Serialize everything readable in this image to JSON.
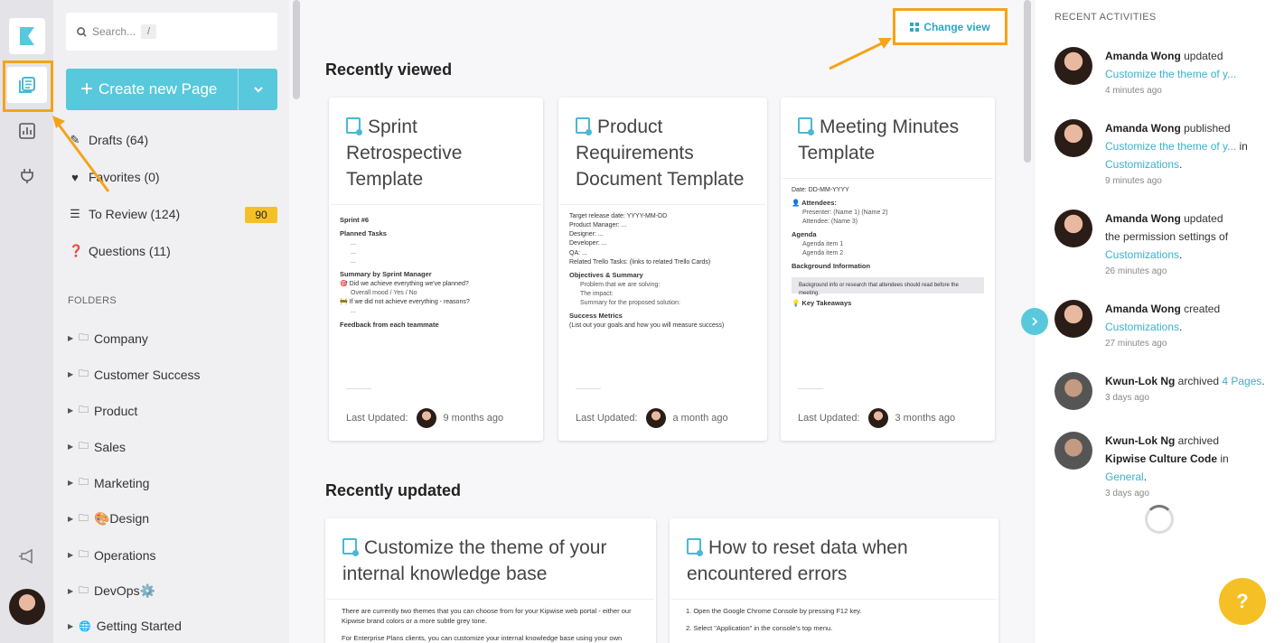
{
  "sidebar": {
    "search_placeholder": "Search...",
    "search_shortcut": "/",
    "create_label": "Create new Page",
    "nav": [
      {
        "label": "Drafts (64)",
        "icon": "pencil-icon"
      },
      {
        "label": "Favorites (0)",
        "icon": "heart-icon"
      },
      {
        "label": "To Review (124)",
        "icon": "review-list-icon",
        "badge": "90"
      },
      {
        "label": "Questions (11)",
        "icon": "question-icon"
      }
    ],
    "folders_title": "FOLDERS",
    "folders": [
      "Company",
      "Customer Success",
      "Product",
      "Sales",
      "Marketing",
      "🎨Design",
      "Operations",
      "DevOps⚙️",
      "Getting Started"
    ]
  },
  "main": {
    "change_view": "Change view",
    "recently_viewed": "Recently viewed",
    "recently_updated": "Recently updated",
    "last_updated_label": "Last Updated:",
    "viewed_cards": [
      {
        "title": "Sprint Retrospective Template",
        "time": "9 months ago"
      },
      {
        "title": "Product Requirements Document Template",
        "time": "a month ago"
      },
      {
        "title": "Meeting Minutes Template",
        "time": "3 months ago"
      }
    ],
    "updated_cards": [
      {
        "title": "Customize the theme of your internal knowledge base",
        "preview1": "There are currently two themes that you can choose from for your Kipwise web portal - either our Kipwise brand colors or a more subtle grey tone.",
        "preview2": "For Enterprise Plans clients, you can customize your internal knowledge base using your own brand"
      },
      {
        "title": "How to reset data when encountered errors",
        "preview1": "1. Open the Google Chrome Console by pressing F12 key.",
        "preview2": "2. Select \"Application\" in the console's top menu."
      }
    ],
    "previews": {
      "sprint": {
        "h": "Sprint #6",
        "planned": "Planned Tasks",
        "dash": "...",
        "summary": "Summary by Sprint Manager",
        "q1": "🎯 Did we achieve everything we've planned?",
        "q1a": "Overall mood / Yes / No",
        "q2": "🚧 If we did not achieve everything - reasons?",
        "feedback": "Feedback from each teammate"
      },
      "prd": {
        "release": "Target release date: YYYY-MM-DD",
        "pm": "Product Manager: ...",
        "designer": "Designer: ...",
        "dev": "Developer: ...",
        "qa": "QA: ...",
        "tasks": "Related Trello Tasks: (links to related Trello Cards)",
        "obj": "Objectives & Summary",
        "o1": "Problem that we are solving:",
        "o2": "The impact:",
        "o3": "Summary for the proposed solution:",
        "metrics": "Success Metrics",
        "m1": "(List out your goals and how you will measure success)"
      },
      "mm": {
        "date": "Date: DD-MM-YYYY",
        "attendees": "👤 Attendees:",
        "a1": "Presenter: (Name 1) (Name 2)",
        "a2": "Attendee: (Name 3)",
        "agenda": "Agenda",
        "g1": "Agenda item 1",
        "g2": "Agenda item 2",
        "bg": "Background Information",
        "bgnote": "Background info or research that attendees should read before the meeting.",
        "takeaways": "💡 Key Takeaways"
      }
    }
  },
  "activities": {
    "title": "RECENT ACTIVITIES",
    "items": [
      {
        "who": "Amanda Wong",
        "pre": " updated",
        "link": "Customize the theme of y...",
        "mid": "",
        "link2": "",
        "post": "",
        "time": "4 minutes ago"
      },
      {
        "who": "Amanda Wong",
        "pre": " published",
        "link": "Customize the theme of y...",
        "mid": " in ",
        "link2": "Customizations",
        "post": ".",
        "time": "9 minutes ago"
      },
      {
        "who": "Amanda Wong",
        "pre": " updated the permission settings of ",
        "link": "Customizations",
        "mid": ".",
        "link2": "",
        "post": "",
        "time": "26 minutes ago"
      },
      {
        "who": "Amanda Wong",
        "pre": " created ",
        "link": "Customizations",
        "mid": ".",
        "link2": "",
        "post": "",
        "time": "27 minutes ago"
      },
      {
        "who": "Kwun-Lok Ng",
        "pre": " archived ",
        "link": "4 Pages",
        "mid": ".",
        "link2": "",
        "post": "",
        "time": "3 days ago"
      },
      {
        "who": "Kwun-Lok Ng",
        "pre": " archived ",
        "bold2": "Kipwise Culture Code",
        "mid": " in ",
        "link2": "General",
        "post": ".",
        "time": "3 days ago"
      }
    ]
  },
  "help_label": "?",
  "colors": {
    "accent": "#58c8dc",
    "highlight": "#f5a31a",
    "badge": "#f5c026"
  }
}
